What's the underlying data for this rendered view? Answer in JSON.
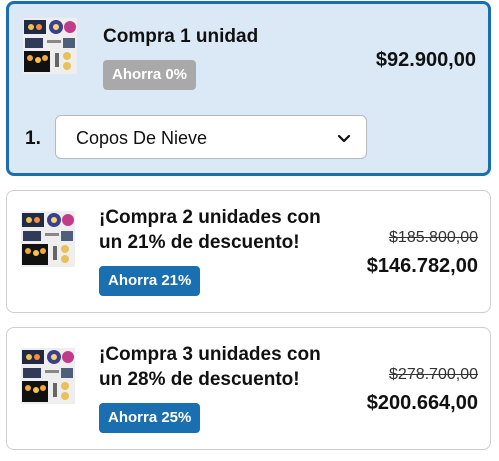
{
  "options": [
    {
      "title": "Compra 1 unidad",
      "badge": "Ahorra 0%",
      "price": "$92.900,00",
      "selected": true,
      "row_index": "1.",
      "variant_value": "Copos De Nieve",
      "variant_icon": "chevron-down-icon"
    },
    {
      "title": "¡Compra 2 unidades con un 21% de descuento!",
      "badge": "Ahorra 21%",
      "old_price": "$185.800,00",
      "price": "$146.782,00",
      "selected": false
    },
    {
      "title": "¡Compra 3 unidades con un 28% de descuento!",
      "badge": "Ahorra 25%",
      "old_price": "$278.700,00",
      "price": "$200.664,00",
      "selected": false
    }
  ],
  "colors": {
    "selected_bg": "#dbe9f7",
    "accent": "#1a6fb0",
    "badge_grey": "#a9a9a9"
  }
}
